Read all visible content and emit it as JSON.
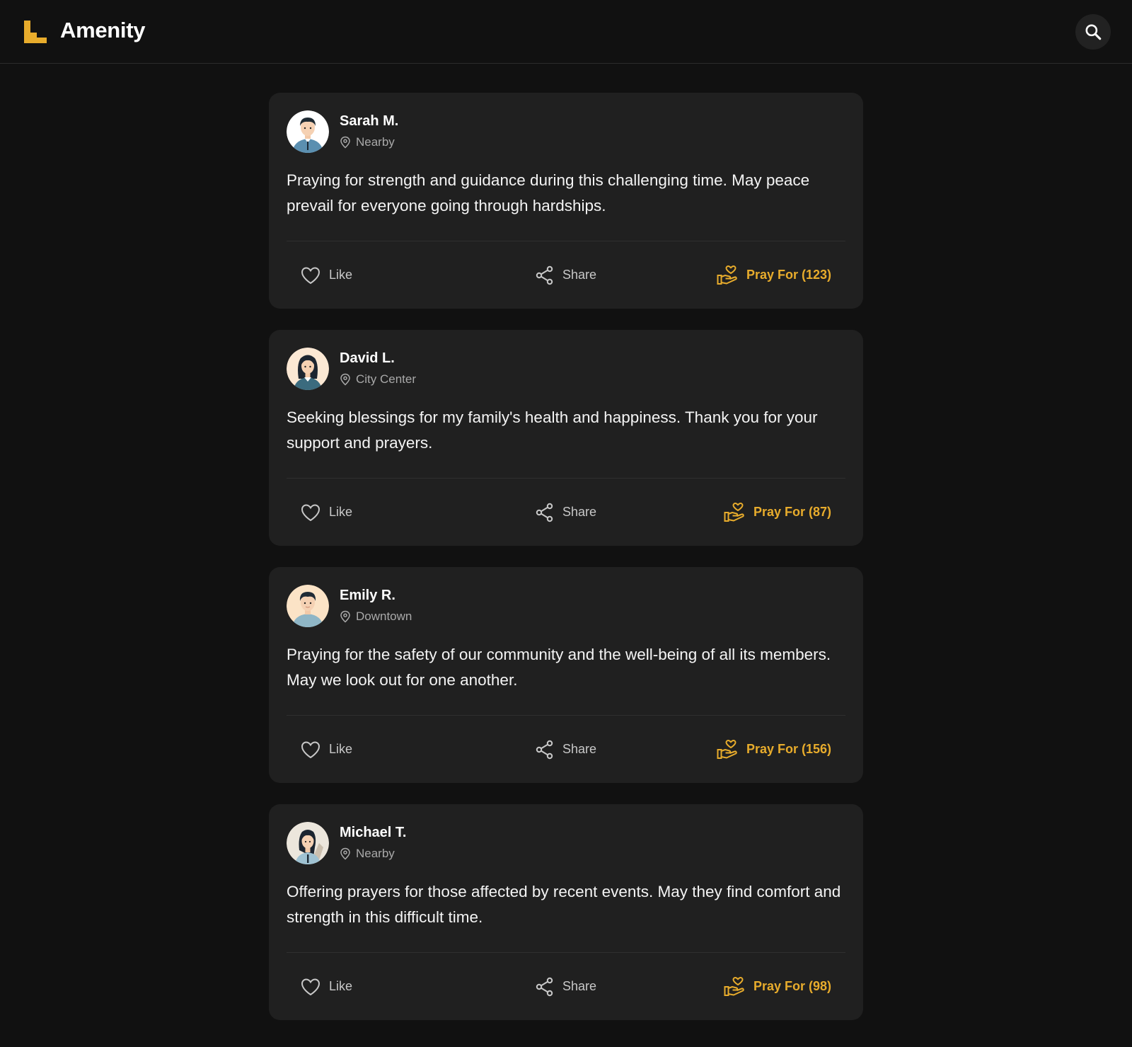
{
  "app": {
    "title": "Amenity",
    "accent_color": "#e8ac2c"
  },
  "header": {
    "logo_icon": "stairs-logo-icon",
    "search_icon": "search-icon"
  },
  "actions": {
    "like_label": "Like",
    "share_label": "Share"
  },
  "posts": [
    {
      "author": "Sarah M.",
      "location": "Nearby",
      "text": "Praying for strength and guidance during this challenging time. May peace prevail for everyone going through hardships.",
      "pray_label": "Pray For (123)",
      "avatar_icon": "man-avatar-icon"
    },
    {
      "author": "David L.",
      "location": "City Center",
      "text": "Seeking blessings for my family's health and happiness. Thank you for your support and prayers.",
      "pray_label": "Pray For (87)",
      "avatar_icon": "woman-avatar-icon"
    },
    {
      "author": "Emily R.",
      "location": "Downtown",
      "text": "Praying for the safety of our community and the well-being of all its members. May we look out for one another.",
      "pray_label": "Pray For (156)",
      "avatar_icon": "man-avatar-icon"
    },
    {
      "author": "Michael T.",
      "location": "Nearby",
      "text": "Offering prayers for those affected by recent events. May they find comfort and strength in this difficult time.",
      "pray_label": "Pray For (98)",
      "avatar_icon": "woman-avatar-icon"
    }
  ]
}
